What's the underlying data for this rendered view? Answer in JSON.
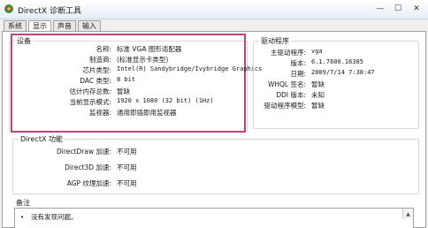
{
  "window": {
    "title": "DirectX 诊断工具",
    "minimize_glyph": "—",
    "maximize_glyph": "☐",
    "close_glyph": "✕"
  },
  "tabs": [
    {
      "label": "系统",
      "active": false
    },
    {
      "label": "显示",
      "active": true
    },
    {
      "label": "声音",
      "active": false
    },
    {
      "label": "输入",
      "active": false
    }
  ],
  "device": {
    "title": "设备",
    "rows": [
      {
        "label": "名称:",
        "value": "标准 VGA 图形适配器"
      },
      {
        "label": "制造商:",
        "value": "(标准显示卡类型)"
      },
      {
        "label": "芯片类型:",
        "value": "Intel(R) Sandybridge/Ivybridge Graphics"
      },
      {
        "label": "DAC 类型:",
        "value": "8 bit"
      },
      {
        "label": "估计内存总数:",
        "value": "暂缺"
      },
      {
        "label": "当前显示模式:",
        "value": "1920 x 1080 (32 bit) (1Hz)"
      },
      {
        "label": "监视器:",
        "value": "通用即插即用监视器"
      }
    ],
    "highlight_color": "#b9457f"
  },
  "driver": {
    "title": "驱动程序",
    "rows": [
      {
        "label": "主驱动程序:",
        "value": "vga"
      },
      {
        "label": "版本:",
        "value": "6.1.7600.16385"
      },
      {
        "label": "日期:",
        "value": "2009/7/14 7:38:47"
      },
      {
        "label": "WHQL 签名:",
        "value": "暂缺"
      },
      {
        "label": "DDI 版本:",
        "value": "未知"
      },
      {
        "label": "驱动程序模型:",
        "value": "暂缺"
      }
    ]
  },
  "directx": {
    "title": "DirectX 功能",
    "rows": [
      {
        "label": "DirectDraw 加速:",
        "value": "不可用"
      },
      {
        "label": "Direct3D 加速:",
        "value": "不可用"
      },
      {
        "label": "AGP 纹理加速:",
        "value": "不可用"
      }
    ]
  },
  "notes": {
    "title": "备注",
    "bullet": "•",
    "text": "没有发现问题。"
  },
  "icons": {
    "app": "directx-app-icon",
    "minimize": "minimize-icon",
    "maximize": "maximize-icon",
    "close": "close-icon",
    "scroll_up": "scroll-up-arrow-icon"
  }
}
